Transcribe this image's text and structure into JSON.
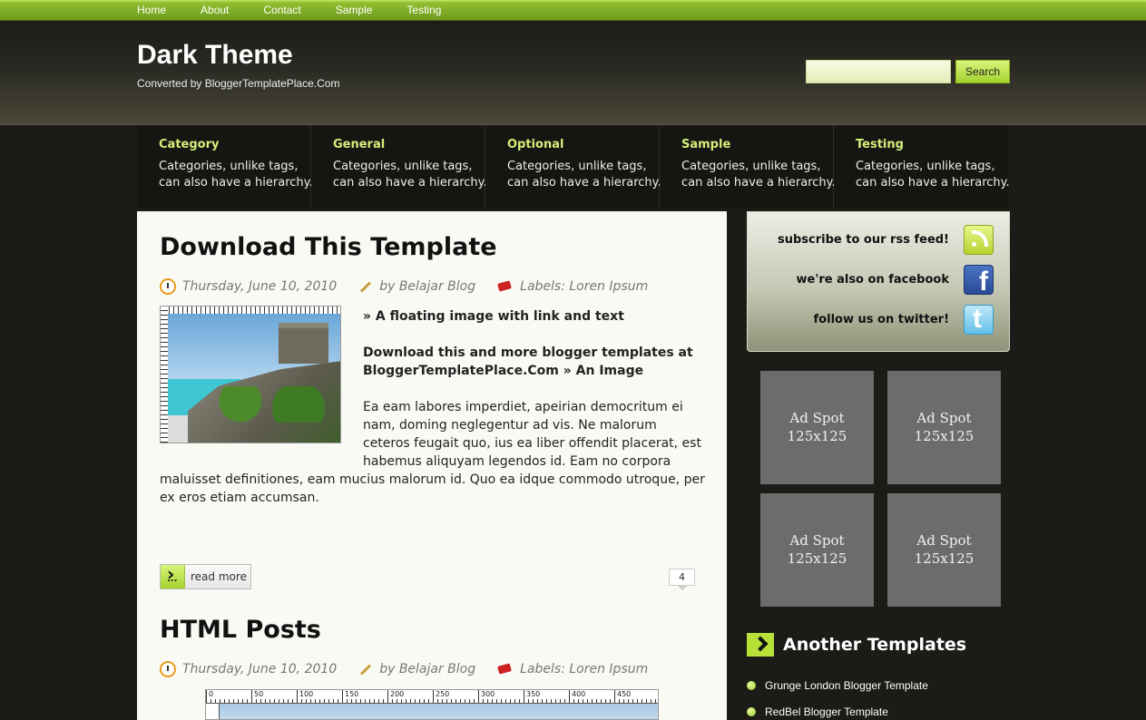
{
  "topnav": [
    "Home",
    "About",
    "Contact",
    "Sample",
    "Testing"
  ],
  "header": {
    "title": "Dark Theme",
    "subtitle": "Converted by BloggerTemplatePlace.Com",
    "search_button": "Search"
  },
  "categories": [
    {
      "title": "Category",
      "desc": "Categories, unlike tags, can also have a hierarchy."
    },
    {
      "title": "General",
      "desc": "Categories, unlike tags, can also have a hierarchy."
    },
    {
      "title": "Optional",
      "desc": "Categories, unlike tags, can also have a hierarchy."
    },
    {
      "title": "Sample",
      "desc": "Categories, unlike tags, can also have a hierarchy."
    },
    {
      "title": "Testing",
      "desc": "Categories, unlike tags, can also have a hierarchy."
    }
  ],
  "posts": [
    {
      "title": "Download This Template",
      "date": "Thursday, June 10, 2010",
      "author": "by Belajar Blog",
      "labels": "Labels: Loren Ipsum",
      "line1": "» A floating image with link and text",
      "line2a": "Download this and more blogger templates at",
      "line2b": "BloggerTemplatePlace.Com » An Image",
      "para_lines": [
        "Ea eam labores imperdiet, apeirian democritum ei",
        "nam, doming neglegentur ad vis. Ne malorum",
        "ceteros feugait quo, ius ea liber offendit placerat, est",
        "habemus aliquyam legendos id. Eam no corpora"
      ],
      "para_full_lines": [
        "maluisset definitiones, eam mucius malorum id. Quo ea idque commodo utroque, per",
        "ex eros etiam accumsan."
      ],
      "read_more": "read more",
      "comments": "4"
    },
    {
      "title": "HTML Posts",
      "date": "Thursday, June 10, 2010",
      "author": "by Belajar Blog",
      "labels": "Labels: Loren Ipsum",
      "ruler": [
        "0",
        "50",
        "100",
        "150",
        "200",
        "250",
        "300",
        "350",
        "400",
        "450"
      ]
    }
  ],
  "social": [
    {
      "text": "subscribe to our rss feed!",
      "icon": "rss-icon"
    },
    {
      "text": "we're also on facebook",
      "icon": "facebook-icon"
    },
    {
      "text": "follow us on twitter!",
      "icon": "twitter-icon"
    }
  ],
  "ads": [
    {
      "line1": "Ad Spot",
      "line2": "125x125"
    },
    {
      "line1": "Ad Spot",
      "line2": "125x125"
    },
    {
      "line1": "Ad Spot",
      "line2": "125x125"
    },
    {
      "line1": "Ad Spot",
      "line2": "125x125"
    }
  ],
  "another_templates": {
    "title": "Another Templates",
    "items": [
      "Grunge London Blogger Template",
      "RedBel Blogger Template"
    ]
  },
  "colors": {
    "accent": "#a5d22e",
    "background": "#1c1b17",
    "content": "#fafaf5"
  }
}
